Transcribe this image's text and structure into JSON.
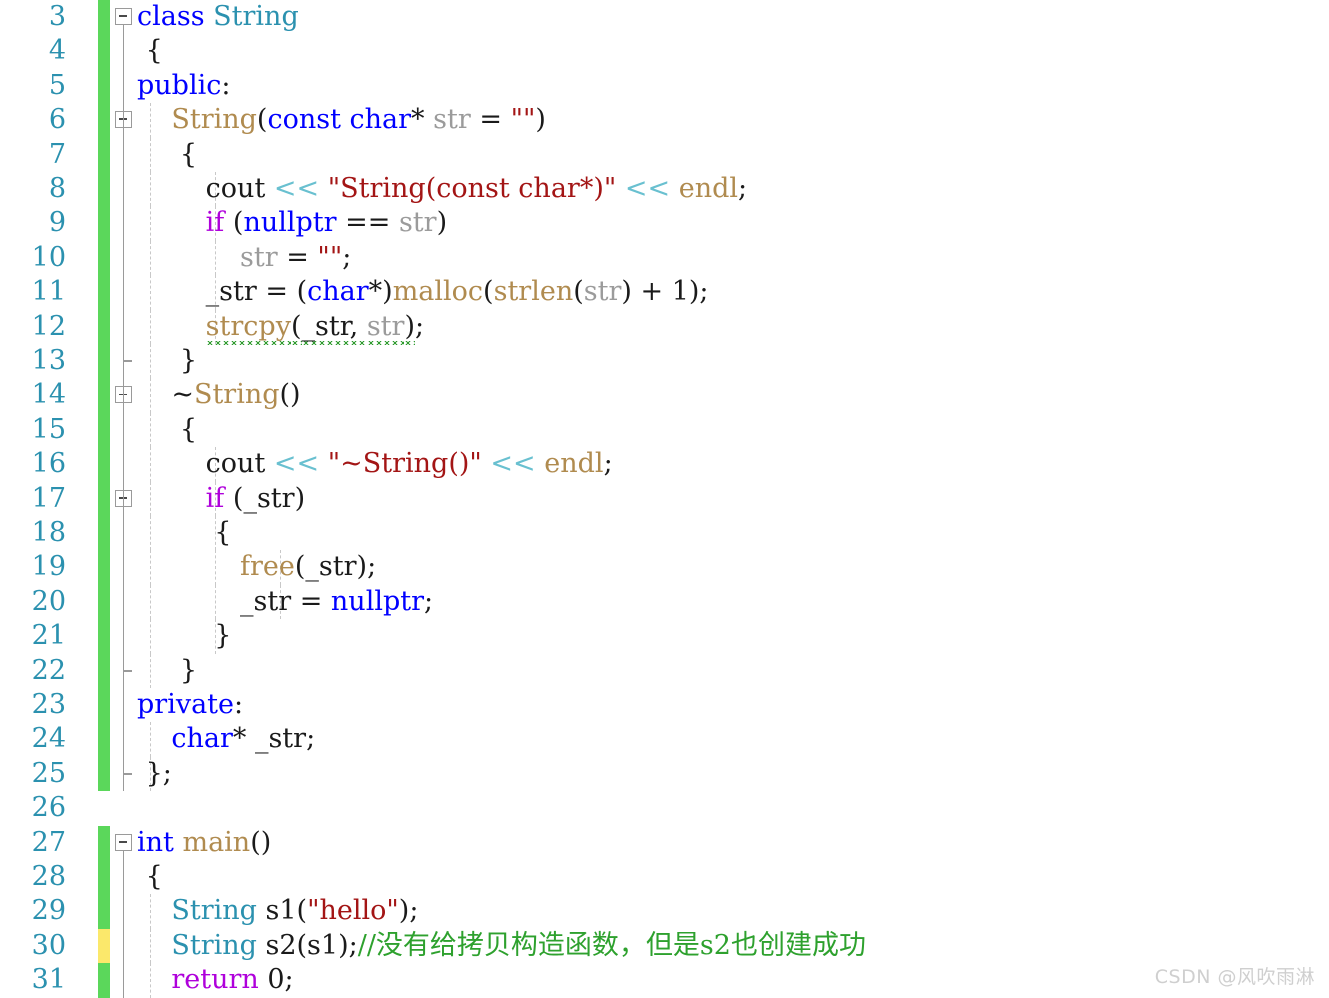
{
  "editor": {
    "language": "cpp",
    "first_line": 3,
    "last_line": 31,
    "colors": {
      "keyword": "#0000FF",
      "control": "#AF00DB",
      "type": "#2B91AF",
      "function": "#B08B4F",
      "string": "#A31515",
      "operator": "#69C0D0",
      "parameter": "#9B9B9B",
      "comment": "#2EA12E",
      "line_number": "#2B91AF",
      "change_saved": "#5BD75B",
      "change_unsaved": "#FBE86B",
      "error_squiggle": "#2E9B2E",
      "background": "#FFFFFF"
    }
  },
  "watermark": "CSDN @风吹雨淋",
  "lines": [
    {
      "n": "3",
      "change": "green",
      "fold": "box",
      "outline": "none",
      "guides": [],
      "tokens": [
        {
          "t": "class",
          "c": "kw"
        },
        {
          "t": " ",
          "c": "plain"
        },
        {
          "t": "String",
          "c": "type"
        }
      ]
    },
    {
      "n": "4",
      "change": "green",
      "fold": "line",
      "outline": "none",
      "guides": [],
      "tokens": [
        {
          "t": " {",
          "c": "plain"
        }
      ]
    },
    {
      "n": "5",
      "change": "green",
      "fold": "line",
      "outline": "none",
      "guides": [],
      "tokens": [
        {
          "t": "public",
          "c": "kw"
        },
        {
          "t": ":",
          "c": "plain"
        }
      ]
    },
    {
      "n": "6",
      "change": "green",
      "fold": "box",
      "outline": "none",
      "guides": [
        1
      ],
      "tokens": [
        {
          "t": "    ",
          "c": "plain"
        },
        {
          "t": "String",
          "c": "fn"
        },
        {
          "t": "(",
          "c": "plain"
        },
        {
          "t": "const",
          "c": "kw"
        },
        {
          "t": " ",
          "c": "plain"
        },
        {
          "t": "char",
          "c": "kw"
        },
        {
          "t": "* ",
          "c": "plain"
        },
        {
          "t": "str",
          "c": "param"
        },
        {
          "t": " = ",
          "c": "plain"
        },
        {
          "t": "\"\"",
          "c": "str"
        },
        {
          "t": ")",
          "c": "plain"
        }
      ]
    },
    {
      "n": "7",
      "change": "green",
      "fold": "line",
      "outline": "none",
      "guides": [
        1
      ],
      "tokens": [
        {
          "t": "     {",
          "c": "plain"
        }
      ]
    },
    {
      "n": "8",
      "change": "green",
      "fold": "line",
      "outline": "none",
      "guides": [
        1,
        2
      ],
      "tokens": [
        {
          "t": "        ",
          "c": "plain"
        },
        {
          "t": "cout",
          "c": "plain"
        },
        {
          "t": " ",
          "c": "plain"
        },
        {
          "t": "<<",
          "c": "op"
        },
        {
          "t": " ",
          "c": "plain"
        },
        {
          "t": "\"String(const char*)\"",
          "c": "str"
        },
        {
          "t": " ",
          "c": "plain"
        },
        {
          "t": "<<",
          "c": "op"
        },
        {
          "t": " ",
          "c": "plain"
        },
        {
          "t": "endl",
          "c": "fn"
        },
        {
          "t": ";",
          "c": "plain"
        }
      ]
    },
    {
      "n": "9",
      "change": "green",
      "fold": "line",
      "outline": "none",
      "guides": [
        1,
        2
      ],
      "tokens": [
        {
          "t": "        ",
          "c": "plain"
        },
        {
          "t": "if",
          "c": "ctrl"
        },
        {
          "t": " (",
          "c": "plain"
        },
        {
          "t": "nullptr",
          "c": "kw"
        },
        {
          "t": " == ",
          "c": "plain"
        },
        {
          "t": "str",
          "c": "param"
        },
        {
          "t": ")",
          "c": "plain"
        }
      ]
    },
    {
      "n": "10",
      "change": "green",
      "fold": "line",
      "outline": "none",
      "guides": [
        1,
        2
      ],
      "tokens": [
        {
          "t": "            ",
          "c": "plain"
        },
        {
          "t": "str",
          "c": "param"
        },
        {
          "t": " = ",
          "c": "plain"
        },
        {
          "t": "\"\"",
          "c": "str"
        },
        {
          "t": ";",
          "c": "plain"
        }
      ]
    },
    {
      "n": "11",
      "change": "green",
      "fold": "line",
      "outline": "none",
      "guides": [
        1,
        2
      ],
      "tokens": [
        {
          "t": "        ",
          "c": "plain"
        },
        {
          "t": "_str",
          "c": "plain"
        },
        {
          "t": " = (",
          "c": "plain"
        },
        {
          "t": "char",
          "c": "kw"
        },
        {
          "t": "*)",
          "c": "plain"
        },
        {
          "t": "malloc",
          "c": "fn"
        },
        {
          "t": "(",
          "c": "plain"
        },
        {
          "t": "strlen",
          "c": "fn"
        },
        {
          "t": "(",
          "c": "plain"
        },
        {
          "t": "str",
          "c": "param"
        },
        {
          "t": ") + 1);",
          "c": "plain"
        }
      ]
    },
    {
      "n": "12",
      "change": "green",
      "fold": "line",
      "outline": "none",
      "guides": [
        1,
        2
      ],
      "error": true,
      "tokens": [
        {
          "t": "        ",
          "c": "plain"
        },
        {
          "t": "strcpy",
          "c": "fn",
          "err": true
        },
        {
          "t": "(",
          "c": "plain",
          "err": true
        },
        {
          "t": "_str",
          "c": "plain",
          "err": true
        },
        {
          "t": ", ",
          "c": "plain",
          "err": true
        },
        {
          "t": "str",
          "c": "param",
          "err": true
        },
        {
          "t": ")",
          "c": "plain",
          "err": true
        },
        {
          "t": ";",
          "c": "plain"
        }
      ]
    },
    {
      "n": "13",
      "change": "green",
      "fold": "endhook",
      "outline": "none",
      "guides": [
        1
      ],
      "tokens": [
        {
          "t": "     }",
          "c": "plain"
        }
      ]
    },
    {
      "n": "14",
      "change": "green",
      "fold": "box",
      "outline": "none",
      "guides": [
        1
      ],
      "tokens": [
        {
          "t": "    ~",
          "c": "plain"
        },
        {
          "t": "String",
          "c": "fn"
        },
        {
          "t": "()",
          "c": "plain"
        }
      ]
    },
    {
      "n": "15",
      "change": "green",
      "fold": "line",
      "outline": "none",
      "guides": [
        1
      ],
      "tokens": [
        {
          "t": "     {",
          "c": "plain"
        }
      ]
    },
    {
      "n": "16",
      "change": "green",
      "fold": "line",
      "outline": "none",
      "guides": [
        1,
        2
      ],
      "tokens": [
        {
          "t": "        ",
          "c": "plain"
        },
        {
          "t": "cout",
          "c": "plain"
        },
        {
          "t": " ",
          "c": "plain"
        },
        {
          "t": "<<",
          "c": "op"
        },
        {
          "t": " ",
          "c": "plain"
        },
        {
          "t": "\"~String()\"",
          "c": "str"
        },
        {
          "t": " ",
          "c": "plain"
        },
        {
          "t": "<<",
          "c": "op"
        },
        {
          "t": " ",
          "c": "plain"
        },
        {
          "t": "endl",
          "c": "fn"
        },
        {
          "t": ";",
          "c": "plain"
        }
      ]
    },
    {
      "n": "17",
      "change": "green",
      "fold": "box",
      "outline": "none",
      "guides": [
        1,
        2
      ],
      "tokens": [
        {
          "t": "        ",
          "c": "plain"
        },
        {
          "t": "if",
          "c": "ctrl"
        },
        {
          "t": " (",
          "c": "plain"
        },
        {
          "t": "_str",
          "c": "plain"
        },
        {
          "t": ")",
          "c": "plain"
        }
      ]
    },
    {
      "n": "18",
      "change": "green",
      "fold": "line",
      "outline": "none",
      "guides": [
        1,
        2
      ],
      "tokens": [
        {
          "t": "         {",
          "c": "plain"
        }
      ]
    },
    {
      "n": "19",
      "change": "green",
      "fold": "line",
      "outline": "none",
      "guides": [
        1,
        2,
        3
      ],
      "tokens": [
        {
          "t": "            ",
          "c": "plain"
        },
        {
          "t": "free",
          "c": "fn"
        },
        {
          "t": "(",
          "c": "plain"
        },
        {
          "t": "_str",
          "c": "plain"
        },
        {
          "t": ");",
          "c": "plain"
        }
      ]
    },
    {
      "n": "20",
      "change": "green",
      "fold": "line",
      "outline": "none",
      "guides": [
        1,
        2,
        3
      ],
      "tokens": [
        {
          "t": "            ",
          "c": "plain"
        },
        {
          "t": "_str",
          "c": "plain"
        },
        {
          "t": " = ",
          "c": "plain"
        },
        {
          "t": "nullptr",
          "c": "kw"
        },
        {
          "t": ";",
          "c": "plain"
        }
      ]
    },
    {
      "n": "21",
      "change": "green",
      "fold": "line",
      "outline": "none",
      "guides": [
        1,
        2
      ],
      "tokens": [
        {
          "t": "         }",
          "c": "plain"
        }
      ]
    },
    {
      "n": "22",
      "change": "green",
      "fold": "endhook",
      "outline": "none",
      "guides": [
        1
      ],
      "tokens": [
        {
          "t": "     }",
          "c": "plain"
        }
      ]
    },
    {
      "n": "23",
      "change": "green",
      "fold": "line",
      "outline": "none",
      "guides": [],
      "tokens": [
        {
          "t": "private",
          "c": "kw"
        },
        {
          "t": ":",
          "c": "plain"
        }
      ]
    },
    {
      "n": "24",
      "change": "green",
      "fold": "line",
      "outline": "none",
      "guides": [
        1
      ],
      "tokens": [
        {
          "t": "    ",
          "c": "plain"
        },
        {
          "t": "char",
          "c": "kw"
        },
        {
          "t": "* ",
          "c": "plain"
        },
        {
          "t": "_str",
          "c": "plain"
        },
        {
          "t": ";",
          "c": "plain"
        }
      ]
    },
    {
      "n": "25",
      "change": "green",
      "fold": "endhook",
      "outline": "none",
      "guides": [
        1
      ],
      "tokens": [
        {
          "t": " };",
          "c": "plain"
        }
      ]
    },
    {
      "n": "26",
      "change": "none",
      "fold": "none",
      "outline": "none",
      "guides": [],
      "tokens": []
    },
    {
      "n": "27",
      "change": "green",
      "fold": "box",
      "outline": "none",
      "guides": [],
      "tokens": [
        {
          "t": "int",
          "c": "kw"
        },
        {
          "t": " ",
          "c": "plain"
        },
        {
          "t": "main",
          "c": "fn"
        },
        {
          "t": "()",
          "c": "plain"
        }
      ]
    },
    {
      "n": "28",
      "change": "green",
      "fold": "line",
      "outline": "none",
      "guides": [],
      "tokens": [
        {
          "t": " {",
          "c": "plain"
        }
      ]
    },
    {
      "n": "29",
      "change": "green",
      "fold": "line",
      "outline": "none",
      "guides": [
        1
      ],
      "tokens": [
        {
          "t": "    ",
          "c": "plain"
        },
        {
          "t": "String",
          "c": "type"
        },
        {
          "t": " s1(",
          "c": "plain"
        },
        {
          "t": "\"hello\"",
          "c": "str"
        },
        {
          "t": ");",
          "c": "plain"
        }
      ]
    },
    {
      "n": "30",
      "change": "yellow",
      "fold": "line",
      "outline": "none",
      "guides": [
        1
      ],
      "tokens": [
        {
          "t": "    ",
          "c": "plain"
        },
        {
          "t": "String",
          "c": "type"
        },
        {
          "t": " s2(s1);",
          "c": "plain"
        },
        {
          "t": "//没有给拷贝构造函数，但是s2也创建成功",
          "c": "cmt"
        }
      ]
    },
    {
      "n": "31",
      "change": "green",
      "fold": "line",
      "outline": "none",
      "guides": [
        1
      ],
      "tokens": [
        {
          "t": "    ",
          "c": "plain"
        },
        {
          "t": "return",
          "c": "ctrl"
        },
        {
          "t": " ",
          "c": "plain"
        },
        {
          "t": "0",
          "c": "num"
        },
        {
          "t": ";",
          "c": "plain"
        }
      ]
    }
  ]
}
